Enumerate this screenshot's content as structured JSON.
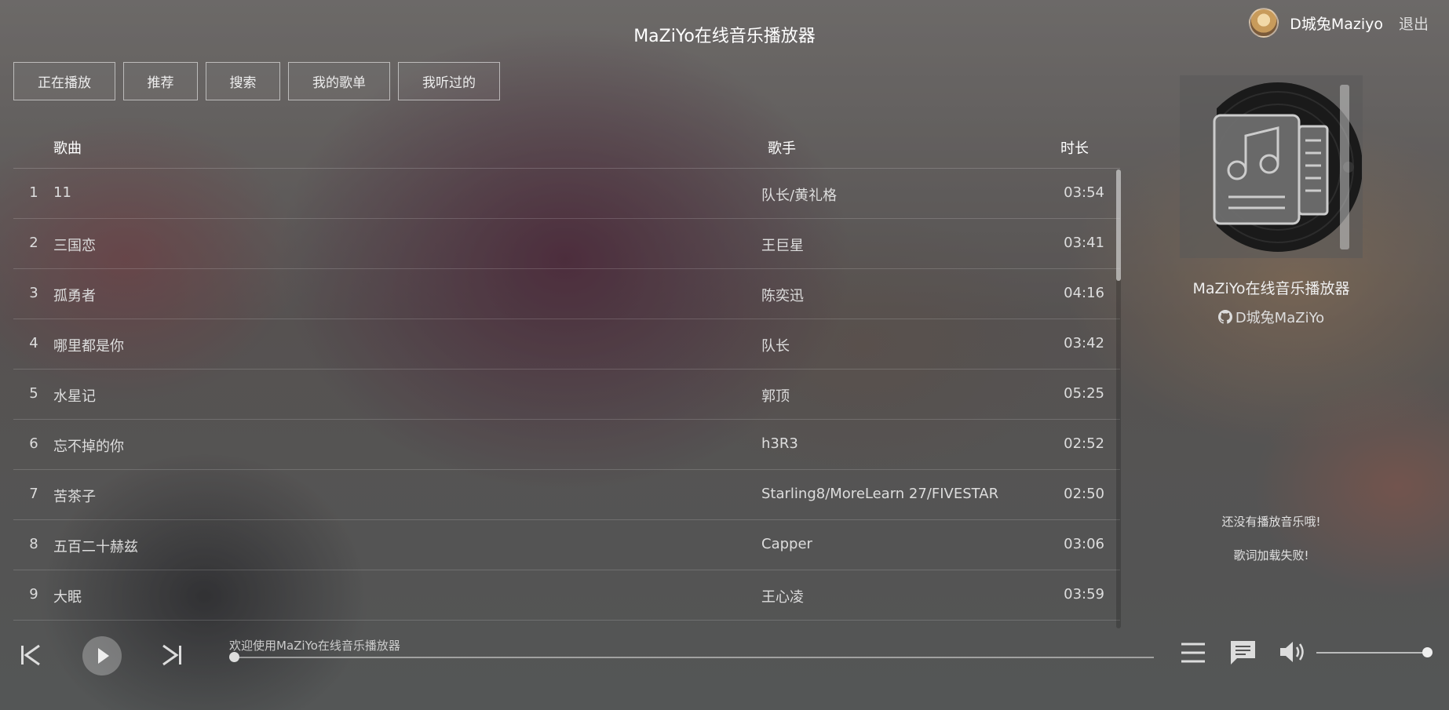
{
  "header": {
    "title": "MaZiYo在线音乐播放器",
    "username": "D城兔Maziyo",
    "logout_label": "退出"
  },
  "nav": {
    "tabs": [
      {
        "label": "正在播放"
      },
      {
        "label": "推荐"
      },
      {
        "label": "搜索"
      },
      {
        "label": "我的歌单"
      },
      {
        "label": "我听过的"
      }
    ]
  },
  "list": {
    "headers": {
      "song": "歌曲",
      "artist": "歌手",
      "duration": "时长"
    },
    "rows": [
      {
        "index": "1",
        "name": "11",
        "artist": "队长/黄礼格",
        "duration": "03:54"
      },
      {
        "index": "2",
        "name": "三国恋",
        "artist": "王巨星",
        "duration": "03:41"
      },
      {
        "index": "3",
        "name": "孤勇者",
        "artist": "陈奕迅",
        "duration": "04:16"
      },
      {
        "index": "4",
        "name": "哪里都是你",
        "artist": "队长",
        "duration": "03:42"
      },
      {
        "index": "5",
        "name": "水星记",
        "artist": "郭顶",
        "duration": "05:25"
      },
      {
        "index": "6",
        "name": "忘不掉的你",
        "artist": "h3R3",
        "duration": "02:52"
      },
      {
        "index": "7",
        "name": "苦茶子",
        "artist": "Starling8/MoreLearn 27/FIVESTAR",
        "duration": "02:50"
      },
      {
        "index": "8",
        "name": "五百二十赫兹",
        "artist": "Capper",
        "duration": "03:06"
      },
      {
        "index": "9",
        "name": "大眠",
        "artist": "王心凌",
        "duration": "03:59"
      }
    ]
  },
  "panel": {
    "title": "MaZiYo在线音乐播放器",
    "author": "D城兔MaZiYo",
    "lyric_status": "还没有播放音乐哦!",
    "lyric_error": "歌词加载失败!"
  },
  "player": {
    "status_text": "欢迎使用MaZiYo在线音乐播放器",
    "progress": 0,
    "volume": 1.0
  },
  "icons": {
    "prev": "skip-previous-icon",
    "play": "play-icon",
    "next": "skip-next-icon",
    "playlist": "playlist-icon",
    "comment": "comment-icon",
    "volume": "volume-icon",
    "github": "github-icon"
  }
}
